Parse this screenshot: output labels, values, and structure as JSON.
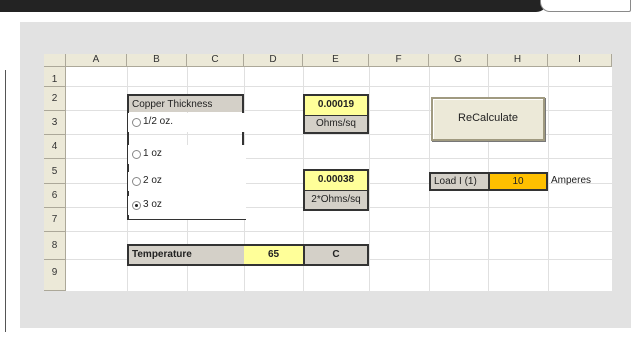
{
  "columns": [
    "A",
    "B",
    "C",
    "D",
    "E",
    "F",
    "G",
    "H",
    "I"
  ],
  "rows": [
    "1",
    "2",
    "3",
    "4",
    "5",
    "6",
    "7",
    "8",
    "9"
  ],
  "copper": {
    "title": "Copper Thickness",
    "options": [
      {
        "label": "1/2 oz.",
        "selected": false
      },
      {
        "label": "1 oz",
        "selected": false
      },
      {
        "label": "2 oz",
        "selected": false
      },
      {
        "label": "3 oz",
        "selected": true
      }
    ]
  },
  "resistance": {
    "value1": "0.00019",
    "unit1": "Ohms/sq",
    "value2": "0.00038",
    "unit2": "2*Ohms/sq"
  },
  "recalculate_label": "ReCalculate",
  "load": {
    "label": "Load I (1)",
    "value": "10",
    "unit": "Amperes"
  },
  "temperature": {
    "label": "Temperature",
    "value": "65",
    "unit": "C"
  },
  "colors": {
    "input_yellow": "#ffff99",
    "input_orange": "#ffc000",
    "label_gray": "#d4d0c8"
  }
}
